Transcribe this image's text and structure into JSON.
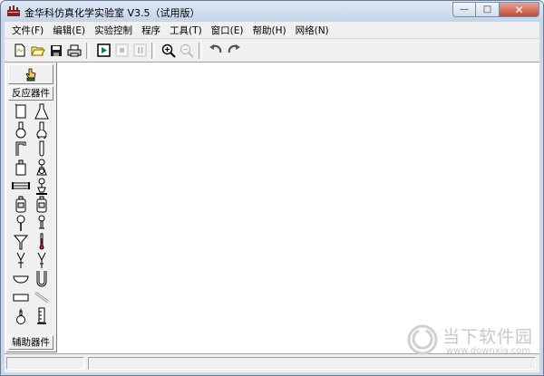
{
  "window": {
    "title": "金华科仿真化学实验室 V3.5（试用版）",
    "buttons": {
      "minimize": "—",
      "maximize": "□",
      "close": "✕"
    }
  },
  "menu": [
    {
      "label": "文件(F)"
    },
    {
      "label": "编辑(E)"
    },
    {
      "label": "实验控制"
    },
    {
      "label": "程序"
    },
    {
      "label": "工具(T)"
    },
    {
      "label": "窗口(E)"
    },
    {
      "label": "帮助(H)"
    },
    {
      "label": "网络(N)"
    }
  ],
  "toolbar": {
    "icons": [
      "new-file-icon",
      "open-folder-icon",
      "save-icon",
      "print-icon",
      "play-icon",
      "stop-icon",
      "pause-icon",
      "zoom-in-icon",
      "zoom-out-icon",
      "undo-icon",
      "redo-icon"
    ]
  },
  "palette": {
    "header": "反应器件",
    "footer": "辅助器件",
    "items": [
      {
        "name": "beaker-icon"
      },
      {
        "name": "erlenmeyer-flask-icon"
      },
      {
        "name": "round-bottom-flask-icon"
      },
      {
        "name": "flat-bottom-flask-icon"
      },
      {
        "name": "bent-tube-icon"
      },
      {
        "name": "test-tube-icon"
      },
      {
        "name": "reagent-bottle-icon"
      },
      {
        "name": "distillation-flask-icon"
      },
      {
        "name": "condenser-tube-icon"
      },
      {
        "name": "retort-stand-icon"
      },
      {
        "name": "gas-bottle-icon"
      },
      {
        "name": "wash-bottle-icon"
      },
      {
        "name": "dropper-bottle-icon"
      },
      {
        "name": "dropper-icon"
      },
      {
        "name": "funnel-icon"
      },
      {
        "name": "thermometer-icon"
      },
      {
        "name": "separatory-funnel-icon"
      },
      {
        "name": "u-tube-icon"
      },
      {
        "name": "evaporating-dish-icon"
      },
      {
        "name": "u-shaped-tube-icon"
      },
      {
        "name": "trough-icon"
      },
      {
        "name": "glass-rod-icon"
      },
      {
        "name": "alcohol-lamp-icon"
      },
      {
        "name": "graduated-cylinder-icon"
      }
    ]
  },
  "watermark": {
    "text": "当下软件园",
    "url": "www.downxia.com"
  },
  "colors": {
    "titlebar": "#c3d4e9",
    "close_button": "#c54a31",
    "window_bg": "#f0f0f0"
  }
}
